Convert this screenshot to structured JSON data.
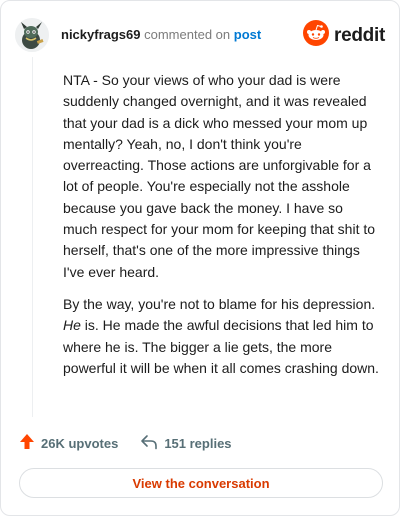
{
  "header": {
    "username": "nickyfrags69",
    "verb": "commented on",
    "target": "post"
  },
  "brand": {
    "wordmark": "reddit",
    "logo_color": "#ff4500"
  },
  "comment": {
    "paragraph1": "NTA - So your views of who your dad is were suddenly changed overnight, and it was revealed that your dad is a dick who messed your mom up mentally? Yeah, no, I don't think you're overreacting. Those actions are unforgivable for a lot of people. You're especially not the asshole because you gave back the money. I have so much respect for your mom for keeping that shit to herself, that's one of the more impressive things I've ever heard.",
    "paragraph2_before": "By the way, you're not to blame for his depression. ",
    "paragraph2_emphasis": "He",
    "paragraph2_after": " is. He made the awful decisions that led him to where he is. The bigger a lie gets, the more powerful it will be when it all comes crashing down."
  },
  "stats": {
    "upvotes": "26K upvotes",
    "replies": "151 replies",
    "upvote_icon": "upvote-arrow-icon",
    "reply_icon": "reply-arrow-icon"
  },
  "cta": {
    "label": "View the conversation",
    "color": "#d93a00"
  }
}
